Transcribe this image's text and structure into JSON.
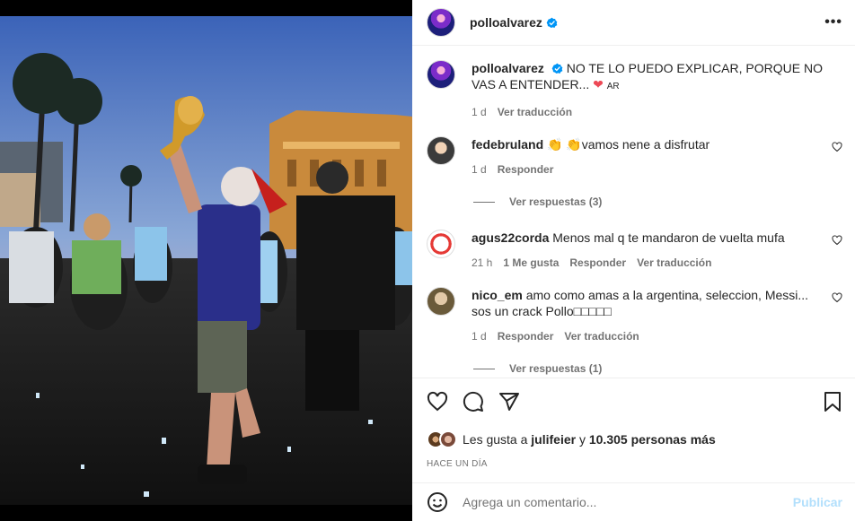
{
  "post": {
    "username": "polloalvarez",
    "caption": "NO TE LO PUEDO EXPLICAR, PORQUE NO VAS A ENTENDER...",
    "caption_suffix": "AR",
    "caption_time": "1 d",
    "caption_translate": "Ver traducción"
  },
  "header": {
    "username": "polloalvarez",
    "more_label": "•••"
  },
  "comments": [
    {
      "username": "fedebruland",
      "text": "👏 👏vamos nene a disfrutar",
      "time": "1 d",
      "reply": "Responder",
      "replies": "Ver respuestas (3)"
    },
    {
      "username": "agus22corda",
      "text": "Menos mal q te mandaron de vuelta mufa",
      "time": "21 h",
      "likes": "1 Me gusta",
      "reply": "Responder",
      "translate": "Ver traducción"
    },
    {
      "username": "nico_em",
      "text": "amo como amas a la argentina, seleccion, Messi... sos un crack Pollo□□□□□",
      "time": "1 d",
      "reply": "Responder",
      "translate": "Ver traducción",
      "replies": "Ver respuestas (1)"
    }
  ],
  "likes": {
    "prefix": "Les gusta a",
    "user": "julifeier",
    "middle": "y",
    "count": "10.305 personas más"
  },
  "timestamp": "HACE UN DÍA",
  "add_comment": {
    "placeholder": "Agrega un comentario...",
    "publish": "Publicar"
  },
  "colors": {
    "accent": "#0095f6",
    "publish_disabled": "#b2dffc",
    "heart": "#ed4956"
  }
}
